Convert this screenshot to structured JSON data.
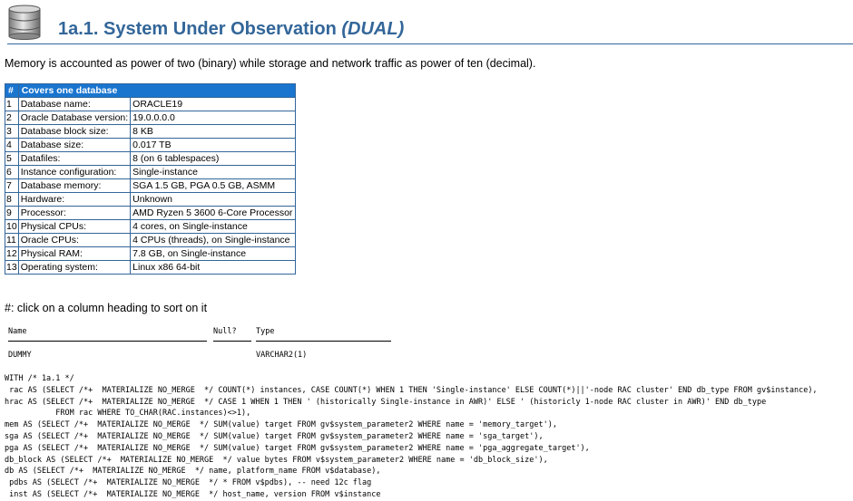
{
  "header": {
    "title": "1a.1. System Under Observation",
    "subtitle": "(DUAL)",
    "icon": "database-icon"
  },
  "intro": "Memory is accounted as power of two (binary) while storage and network traffic as power of ten (decimal).",
  "table": {
    "headers": [
      "#",
      "Covers one database"
    ],
    "rows": [
      {
        "n": "1",
        "k": "Database name:",
        "v": "ORACLE19"
      },
      {
        "n": "2",
        "k": "Oracle Database version:",
        "v": "19.0.0.0.0"
      },
      {
        "n": "3",
        "k": "Database block size:",
        "v": "8 KB"
      },
      {
        "n": "4",
        "k": "Database size:",
        "v": "0.017 TB"
      },
      {
        "n": "5",
        "k": "Datafiles:",
        "v": "8 (on 6 tablespaces)"
      },
      {
        "n": "6",
        "k": "Instance configuration:",
        "v": "Single-instance"
      },
      {
        "n": "7",
        "k": "Database memory:",
        "v": "SGA 1.5 GB, PGA 0.5 GB, ASMM"
      },
      {
        "n": "8",
        "k": "Hardware:",
        "v": "Unknown"
      },
      {
        "n": "9",
        "k": "Processor:",
        "v": "AMD Ryzen 5 3600 6-Core Processor"
      },
      {
        "n": "10",
        "k": "Physical CPUs:",
        "v": "4 cores, on Single-instance"
      },
      {
        "n": "11",
        "k": "Oracle CPUs:",
        "v": "4 CPUs (threads), on Single-instance"
      },
      {
        "n": "12",
        "k": "Physical RAM:",
        "v": "7.8 GB, on Single-instance"
      },
      {
        "n": "13",
        "k": "Operating system:",
        "v": "Linux x86 64-bit"
      }
    ]
  },
  "hint": "#: click on a column heading to sort on it",
  "describe": {
    "columns": [
      "Name",
      "Null?",
      "Type"
    ],
    "row": {
      "name": "DUMMY",
      "null": "",
      "type": "VARCHAR2(1)"
    }
  },
  "sql": [
    "WITH /* 1a.1 */",
    " rac AS (SELECT /*+  MATERIALIZE NO_MERGE  */ COUNT(*) instances, CASE COUNT(*) WHEN 1 THEN 'Single-instance' ELSE COUNT(*)||'-node RAC cluster' END db_type FROM gv$instance),",
    "hrac AS (SELECT /*+  MATERIALIZE NO_MERGE  */ CASE 1 WHEN 1 THEN ' (historically Single-instance in AWR)' ELSE ' (historicly 1-node RAC cluster in AWR)' END db_type",
    "           FROM rac WHERE TO_CHAR(RAC.instances)<>1),",
    "mem AS (SELECT /*+  MATERIALIZE NO_MERGE  */ SUM(value) target FROM gv$system_parameter2 WHERE name = 'memory_target'),",
    "sga AS (SELECT /*+  MATERIALIZE NO_MERGE  */ SUM(value) target FROM gv$system_parameter2 WHERE name = 'sga_target'),",
    "pga AS (SELECT /*+  MATERIALIZE NO_MERGE  */ SUM(value) target FROM gv$system_parameter2 WHERE name = 'pga_aggregate_target'),",
    "db_block AS (SELECT /*+  MATERIALIZE NO_MERGE  */ value bytes FROM v$system_parameter2 WHERE name = 'db_block_size'),",
    "db AS (SELECT /*+  MATERIALIZE NO_MERGE  */ name, platform_name FROM v$database),",
    " pdbs AS (SELECT /*+  MATERIALIZE NO_MERGE  */ * FROM v$pdbs), -- need 12c flag",
    " inst AS (SELECT /*+  MATERIALIZE NO_MERGE  */ host_name, version FROM v$instance"
  ]
}
